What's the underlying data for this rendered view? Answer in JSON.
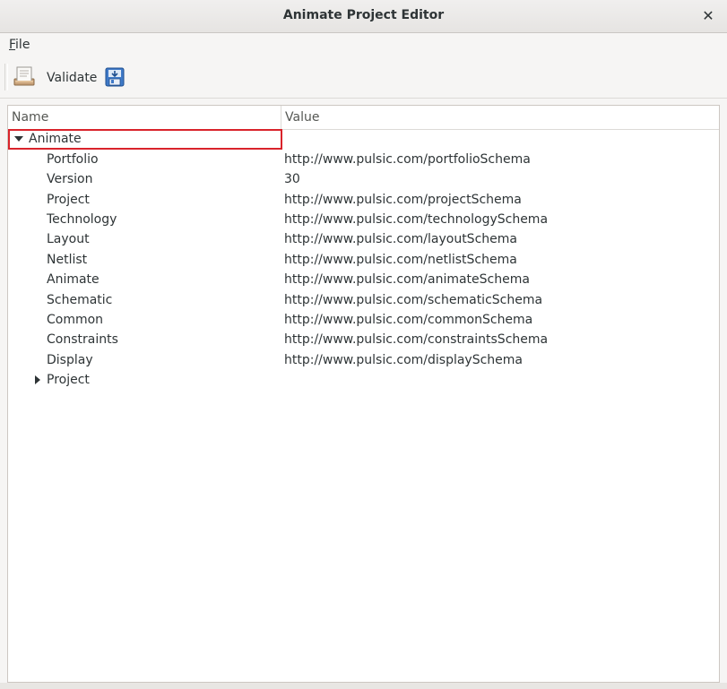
{
  "window": {
    "title": "Animate Project Editor",
    "close_glyph": "✕"
  },
  "menubar": {
    "file": {
      "mnemonic": "F",
      "rest": "ile"
    }
  },
  "toolbar": {
    "validate_label": "Validate",
    "validate_icon": "clipboard-icon",
    "save_icon": "save-download-icon"
  },
  "tree": {
    "columns": {
      "name": "Name",
      "value": "Value"
    },
    "root": {
      "name": "Animate",
      "expanded": true
    },
    "rows": [
      {
        "name": "Portfolio",
        "value": "http://www.pulsic.com/portfolioSchema"
      },
      {
        "name": "Version",
        "value": "30"
      },
      {
        "name": "Project",
        "value": "http://www.pulsic.com/projectSchema"
      },
      {
        "name": "Technology",
        "value": "http://www.pulsic.com/technologySchema"
      },
      {
        "name": "Layout",
        "value": "http://www.pulsic.com/layoutSchema"
      },
      {
        "name": "Netlist",
        "value": "http://www.pulsic.com/netlistSchema"
      },
      {
        "name": "Animate",
        "value": "http://www.pulsic.com/animateSchema"
      },
      {
        "name": "Schematic",
        "value": "http://www.pulsic.com/schematicSchema"
      },
      {
        "name": "Common",
        "value": "http://www.pulsic.com/commonSchema"
      },
      {
        "name": "Constraints",
        "value": "http://www.pulsic.com/constraintsSchema"
      },
      {
        "name": "Display",
        "value": "http://www.pulsic.com/displaySchema"
      }
    ],
    "child_node": {
      "name": "Project",
      "expanded": false
    }
  },
  "colors": {
    "highlight": "#d9232b",
    "background": "#f6f5f4"
  }
}
